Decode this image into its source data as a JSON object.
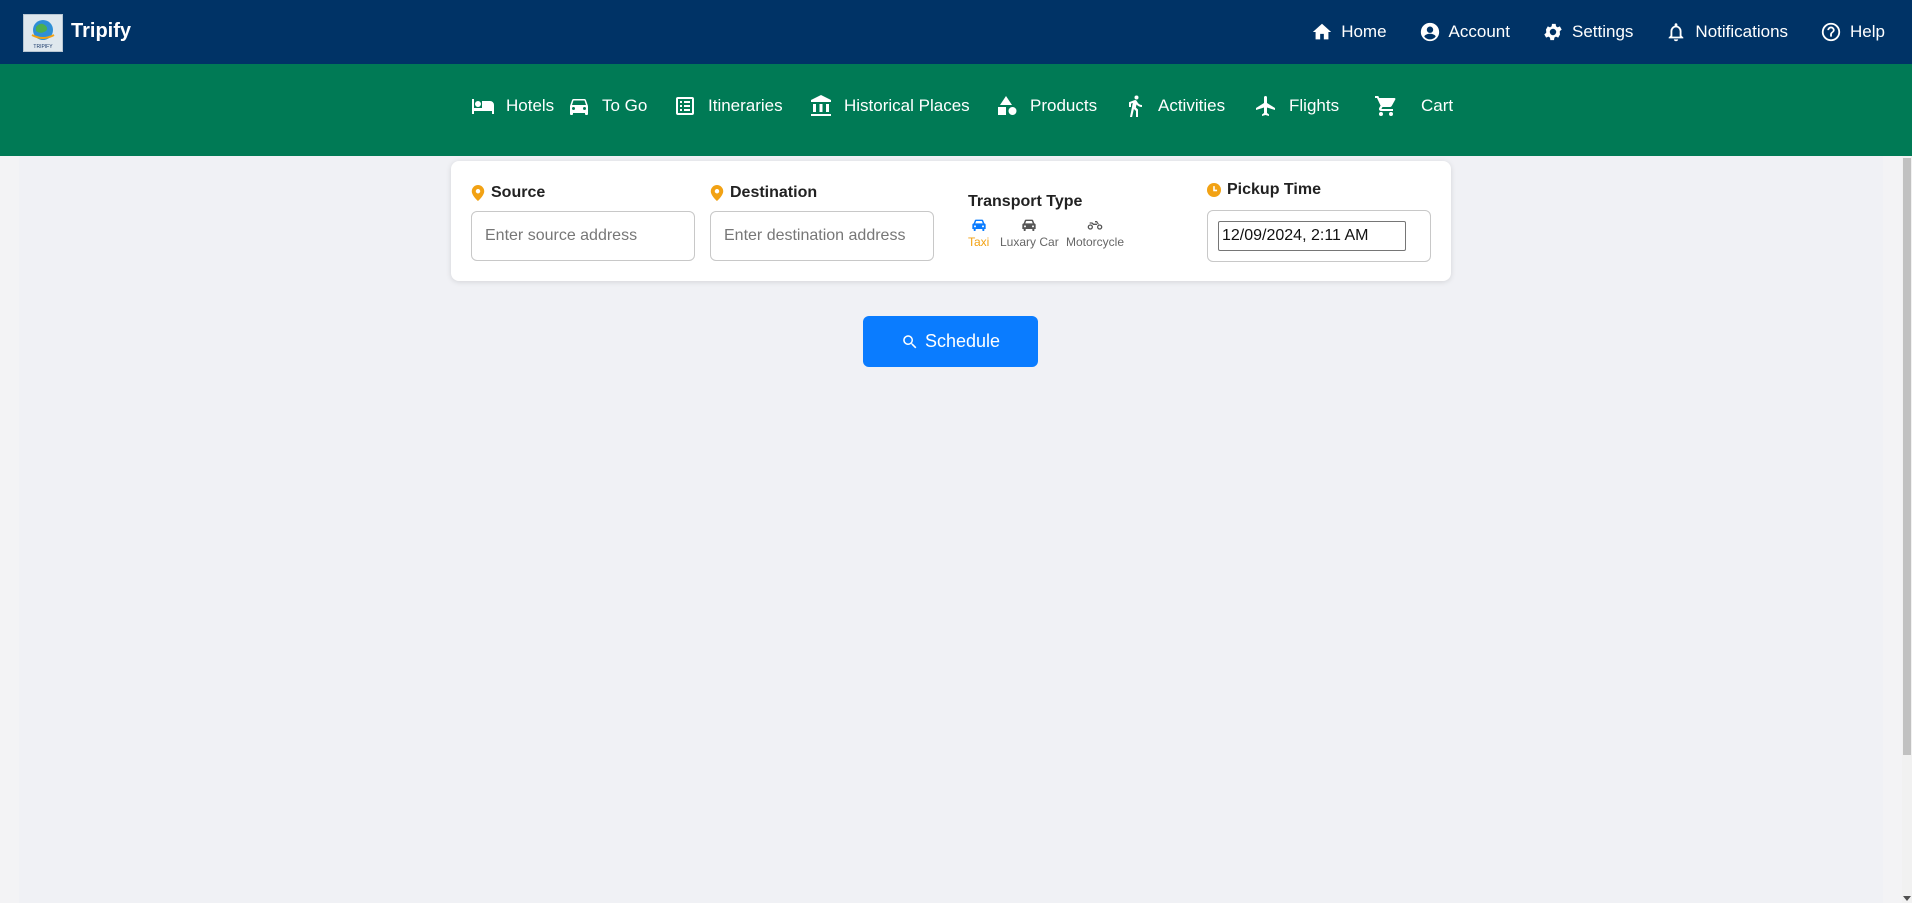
{
  "app": {
    "brand": "Tripify",
    "logo_text": "TRIPIFY"
  },
  "topnav": [
    {
      "label": "Home",
      "icon": "home-icon"
    },
    {
      "label": "Account",
      "icon": "account-icon"
    },
    {
      "label": "Settings",
      "icon": "gear-icon"
    },
    {
      "label": "Notifications",
      "icon": "bell-icon"
    },
    {
      "label": "Help",
      "icon": "help-icon"
    }
  ],
  "subnav": [
    {
      "label": "Hotels",
      "icon": "bed-icon"
    },
    {
      "label": "To Go",
      "icon": "car-icon"
    },
    {
      "label": "Itineraries",
      "icon": "list-icon"
    },
    {
      "label": "Historical Places",
      "icon": "museum-icon"
    },
    {
      "label": "Products",
      "icon": "shapes-icon"
    },
    {
      "label": "Activities",
      "icon": "running-icon"
    },
    {
      "label": "Flights",
      "icon": "plane-icon"
    },
    {
      "label": "Cart",
      "icon": "cart-icon"
    }
  ],
  "form": {
    "source": {
      "label": "Source",
      "placeholder": "Enter source address",
      "value": ""
    },
    "destination": {
      "label": "Destination",
      "placeholder": "Enter destination address",
      "value": ""
    },
    "transport": {
      "label": "Transport Type",
      "selected": "Taxi",
      "options": [
        {
          "label": "Taxi",
          "icon": "taxi-icon"
        },
        {
          "label": "Luxary Car",
          "icon": "car-icon"
        },
        {
          "label": "Motorcycle",
          "icon": "motorcycle-icon"
        }
      ]
    },
    "pickup": {
      "label": "Pickup Time",
      "value": "12/09/2024, 2:11 AM"
    }
  },
  "schedule_button": {
    "label": "Schedule"
  },
  "colors": {
    "topbar": "#003366",
    "subnav": "#007a55",
    "accent": "#0a7cff",
    "icon_orange": "#f2a214"
  }
}
